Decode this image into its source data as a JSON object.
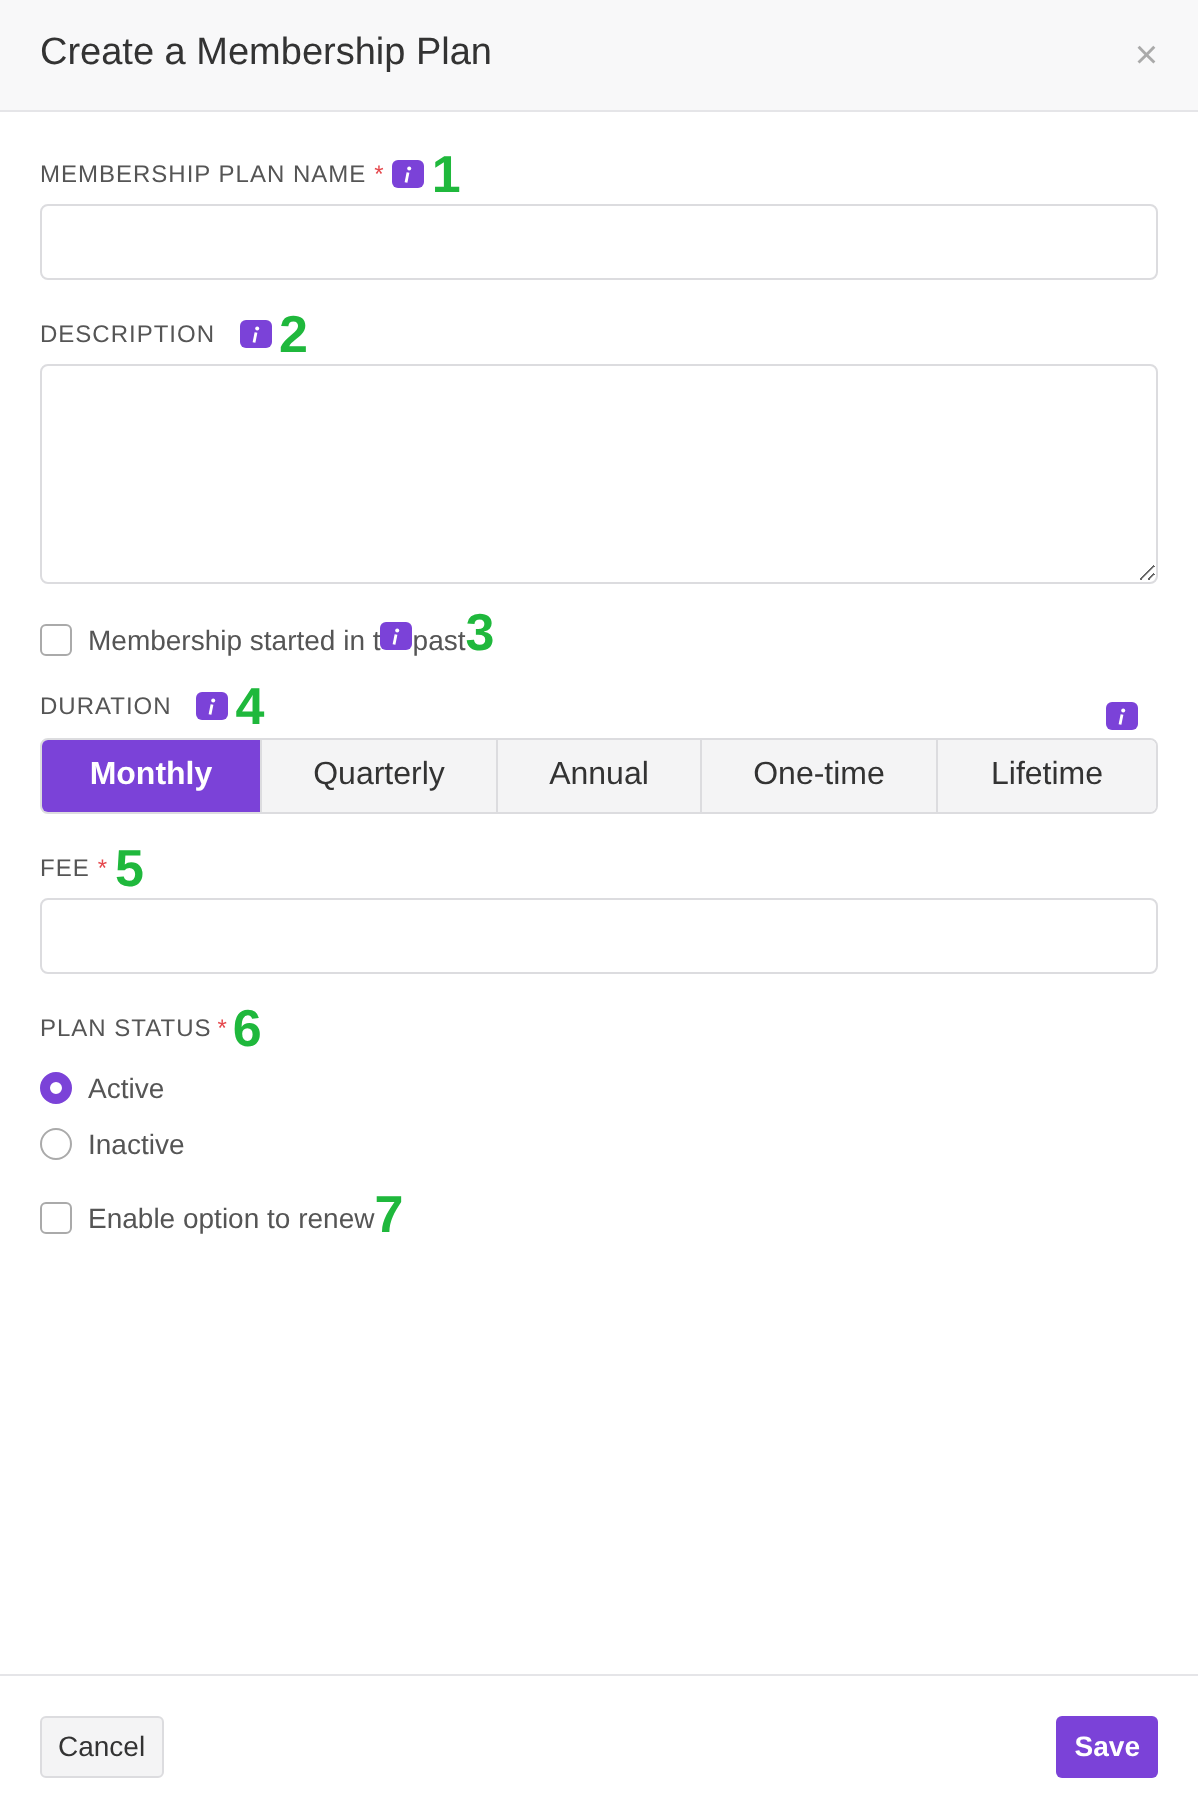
{
  "dialog": {
    "title": "Create a Membership Plan",
    "close": "×"
  },
  "fields": [
    {
      "kind": "text",
      "label": "MEMBERSHIP PLAN NAME",
      "required_mark": "*",
      "annotation": "1"
    },
    {
      "kind": "textarea",
      "label": "DESCRIPTION",
      "annotation": "2"
    }
  ],
  "past_checkbox": {
    "text_before": "Membership started in t",
    "text_after": "past",
    "checked": false,
    "annotation": "3"
  },
  "duration": {
    "label": "DURATION",
    "annotation": "4",
    "options": [
      {
        "label": "Monthly",
        "selected": true
      },
      {
        "label": "Quarterly",
        "selected": false
      },
      {
        "label": "Annual",
        "selected": false
      },
      {
        "label": "One-time",
        "selected": false
      },
      {
        "label": "Lifetime",
        "selected": false
      }
    ]
  },
  "fee": {
    "label": "FEE",
    "required_mark": "*",
    "annotation": "5"
  },
  "plan_status": {
    "label": "PLAN STATUS",
    "required_mark": "*",
    "annotation": "6",
    "options": [
      {
        "label": "Active",
        "selected": true
      },
      {
        "label": "Inactive",
        "selected": false
      }
    ]
  },
  "renew": {
    "label": "Enable option to renew",
    "checked": false,
    "annotation": "7"
  },
  "footer": {
    "cancel": "Cancel",
    "save": "Save"
  }
}
